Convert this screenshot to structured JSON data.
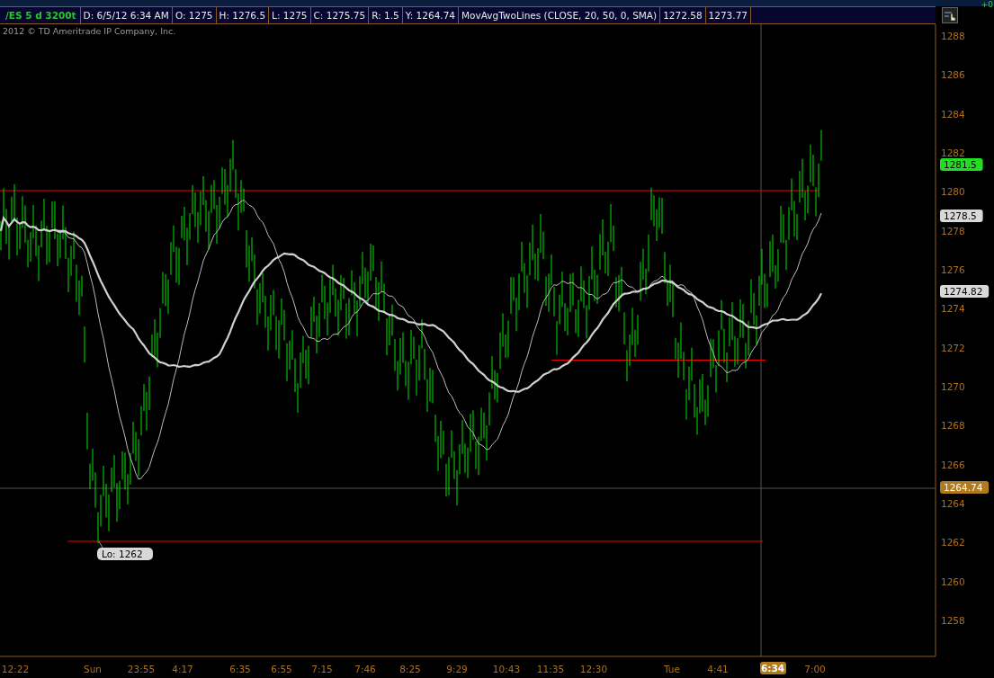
{
  "corner_reading": "+0",
  "header": {
    "symbol": "/ES 5 d 3200t",
    "fields": [
      "D: 6/5/12 6:34 AM",
      "O: 1275",
      "H: 1276.5",
      "L: 1275",
      "C: 1275.75",
      "R: 1.5",
      "Y: 1264.74",
      "MovAvgTwoLines (CLOSE, 20, 50, 0, SMA)",
      "1272.58",
      "1273.77"
    ]
  },
  "copyright": "2012 © TD Ameritrade IP Company, Inc.",
  "y_axis": {
    "labels": [
      "1288",
      "1286",
      "1284",
      "1282",
      "1280",
      "1278",
      "1276",
      "1274",
      "1272",
      "1270",
      "1268",
      "1266",
      "1264",
      "1262",
      "1260",
      "1258"
    ]
  },
  "price_tags": [
    {
      "label": "1281.5",
      "kind": "last"
    },
    {
      "label": "1278.5",
      "kind": "study"
    },
    {
      "label": "1274.82",
      "kind": "study"
    },
    {
      "label": "1264.74",
      "kind": "cursor"
    }
  ],
  "low_label": "Lo: 1262",
  "x_axis": {
    "labels": [
      {
        "text": "12:22",
        "kind": "tick"
      },
      {
        "text": "Sun",
        "kind": "tick"
      },
      {
        "text": "23:55",
        "kind": "tick"
      },
      {
        "text": "4:17",
        "kind": "tick"
      },
      {
        "text": "6:35",
        "kind": "tick"
      },
      {
        "text": "6:55",
        "kind": "tick"
      },
      {
        "text": "7:15",
        "kind": "tick"
      },
      {
        "text": "7:46",
        "kind": "tick"
      },
      {
        "text": "8:25",
        "kind": "tick"
      },
      {
        "text": "9:29",
        "kind": "tick"
      },
      {
        "text": "10:43",
        "kind": "tick"
      },
      {
        "text": "11:35",
        "kind": "tick"
      },
      {
        "text": "12:30",
        "kind": "tick"
      },
      {
        "text": "Tue",
        "kind": "tick"
      },
      {
        "text": "4:41",
        "kind": "tick"
      },
      {
        "text": "6:34",
        "kind": "cursor"
      },
      {
        "text": "7:00",
        "kind": "tick"
      }
    ]
  }
}
